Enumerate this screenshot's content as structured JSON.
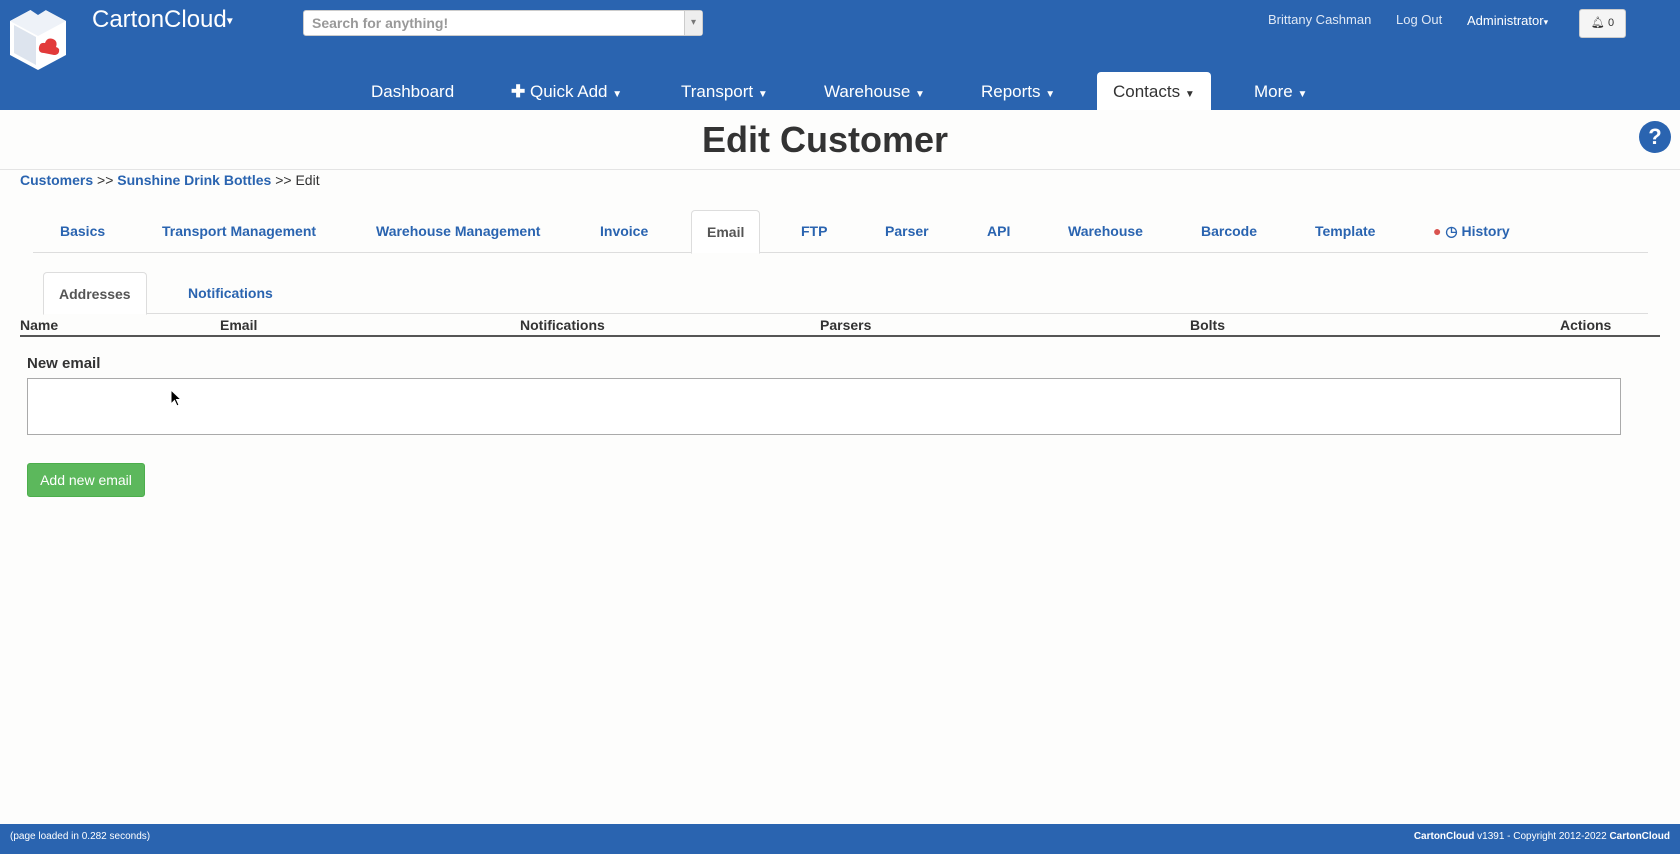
{
  "app": {
    "brand": "CartonCloud",
    "search_placeholder": "Search for anything!"
  },
  "header": {
    "user_name": "Brittany Cashman",
    "logout": "Log Out",
    "role": "Administrator",
    "notifications_count": "0"
  },
  "nav": [
    {
      "label": "Dashboard"
    },
    {
      "label": "Quick Add"
    },
    {
      "label": "Transport"
    },
    {
      "label": "Warehouse"
    },
    {
      "label": "Reports"
    },
    {
      "label": "Contacts"
    },
    {
      "label": "More"
    }
  ],
  "page": {
    "title": "Edit Customer",
    "help_icon": "?"
  },
  "breadcrumb": {
    "items": [
      "Customers",
      "Sunshine Drink Bottles",
      "Edit"
    ],
    "separator": ">>"
  },
  "tabs": [
    {
      "label": "Basics"
    },
    {
      "label": "Transport Management"
    },
    {
      "label": "Warehouse Management"
    },
    {
      "label": "Invoice"
    },
    {
      "label": "Email"
    },
    {
      "label": "FTP"
    },
    {
      "label": "Parser"
    },
    {
      "label": "API"
    },
    {
      "label": "Warehouse"
    },
    {
      "label": "Barcode"
    },
    {
      "label": "Template"
    },
    {
      "label": "History"
    }
  ],
  "active_tab": "Email",
  "subtabs": [
    {
      "label": "Addresses"
    },
    {
      "label": "Notifications"
    }
  ],
  "active_subtab": "Addresses",
  "table": {
    "columns": [
      "Name",
      "Email",
      "Notifications",
      "Parsers",
      "Bolts",
      "Actions"
    ],
    "rows": []
  },
  "new_email": {
    "label": "New email",
    "value": "",
    "button": "Add new email"
  },
  "footer": {
    "left": "(page loaded in 0.282 seconds)",
    "right_brand": "CartonCloud",
    "right_text": "v1391 - Copyright 2012-2022",
    "right_brand2": "CartonCloud"
  },
  "colors": {
    "primary": "#2a64b0",
    "success": "#5cb85c",
    "danger": "#d9534f"
  }
}
